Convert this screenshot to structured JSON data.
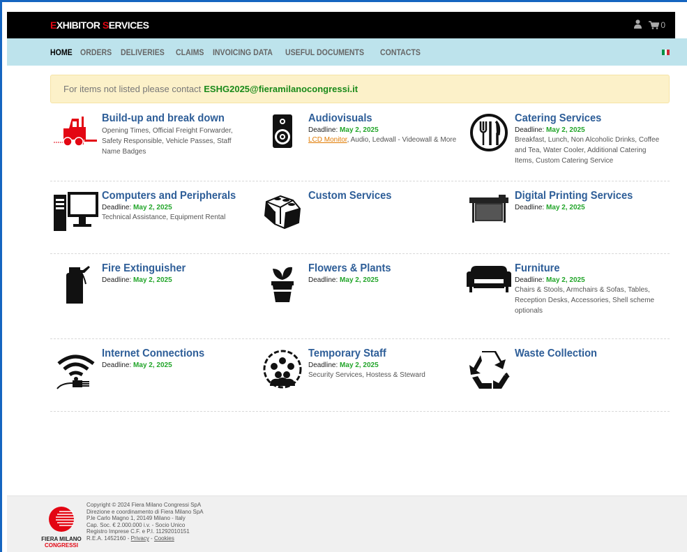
{
  "header": {
    "logo_pre": "E",
    "logo_mid": "XHIBITOR ",
    "logo_s": "S",
    "logo_post": "ERVICES",
    "cart_count": "0"
  },
  "nav": {
    "items": [
      "HOME",
      "ORDERS",
      "DELIVERIES",
      "CLAIMS",
      "INVOICING DATA",
      "USEFUL DOCUMENTS",
      "CONTACTS"
    ],
    "active": "HOME"
  },
  "alert": {
    "text": "For items not listed please contact",
    "email": "ESHG2025@fieramilanocongressi.it"
  },
  "services": [
    {
      "title": "Build-up and break down",
      "icon": "forklift-icon",
      "deadline": "",
      "link": "",
      "desc": "Opening Times, Official Freight Forwarder, Safety Responsible, Vehicle Passes, Staff Name Badges"
    },
    {
      "title": "Audiovisuals",
      "icon": "speaker-icon",
      "deadline": "May 2, 2025",
      "link": "LCD Monitor",
      "desc": ", Audio, Ledwall - Videowall & More"
    },
    {
      "title": "Catering Services",
      "icon": "cutlery-icon",
      "deadline": "May 2, 2025",
      "link": "",
      "desc": "Breakfast, Lunch, Non Alcoholic Drinks, Coffee and Tea, Water Cooler, Additional Catering Items, Custom Catering Service"
    },
    {
      "title": "Computers and Peripherals",
      "icon": "computer-icon",
      "deadline": "May 2, 2025",
      "link": "",
      "desc": "Technical Assistance, Equipment Rental"
    },
    {
      "title": "Custom Services",
      "icon": "blocks-icon",
      "deadline": "",
      "link": "",
      "desc": ""
    },
    {
      "title": "Digital Printing Services",
      "icon": "printer-icon",
      "deadline": "May 2, 2025",
      "link": "",
      "desc": ""
    },
    {
      "title": "Fire Extinguisher",
      "icon": "extinguisher-icon",
      "deadline": "May 2, 2025",
      "link": "",
      "desc": ""
    },
    {
      "title": "Flowers & Plants",
      "icon": "plant-icon",
      "deadline": "May 2, 2025",
      "link": "",
      "desc": ""
    },
    {
      "title": "Furniture",
      "icon": "sofa-icon",
      "deadline": "May 2, 2025",
      "link": "",
      "desc": "Chairs & Stools, Armchairs & Sofas, Tables, Reception Desks, Accessories, Shell scheme optionals"
    },
    {
      "title": "Internet Connections",
      "icon": "wifi-icon",
      "deadline": "May 2, 2025",
      "link": "",
      "desc": ""
    },
    {
      "title": "Temporary Staff",
      "icon": "people-icon",
      "deadline": "May 2, 2025",
      "link": "",
      "desc": "Security Services, Hostess & Steward"
    },
    {
      "title": "Waste Collection",
      "icon": "recycle-icon",
      "deadline": "",
      "link": "",
      "desc": ""
    }
  ],
  "deadline_label": "Deadline:",
  "footer": {
    "brand1": "FIERA MILANO",
    "brand2": "CONGRESSI",
    "lines": [
      "Copyright © 2024 Fiera Milano Congressi SpA",
      "Direzione e coordinamento di Fiera Milano SpA",
      "P.le Carlo Magno 1, 20149 Milano - Italy",
      "Cap. Soc. € 2.000.000 i.v. - Socio Unico",
      "Registro Imprese C.F. e P.I. 11292010151"
    ],
    "rea": "R.E.A. 1452160 - ",
    "privacy": "Privacy",
    "sep": " - ",
    "cookies": "Cookies"
  },
  "colors": {
    "accent": "#2e5e98",
    "deadline": "#22a52a",
    "navbar": "#bde3ec",
    "alert": "#fcf1c9",
    "brand_red": "#e30613"
  }
}
